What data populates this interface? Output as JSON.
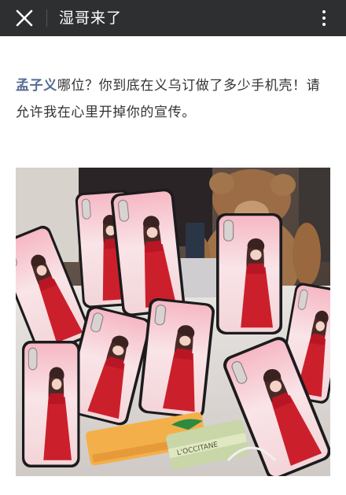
{
  "topbar": {
    "title": "湿哥来了",
    "close_icon": "close-icon",
    "more_icon": "more-vertical-icon"
  },
  "article": {
    "mention": "孟子义",
    "body": "哪位？你到底在义乌订做了多少手机壳！请允许我在心里开掉你的宣传。"
  },
  "photo": {
    "description_icon": "photo-of-phone-cases",
    "product_text": "L'OCCITANE"
  },
  "colors": {
    "topbar_bg": "#2e2f31",
    "mention": "#576b95",
    "text": "#333333"
  }
}
